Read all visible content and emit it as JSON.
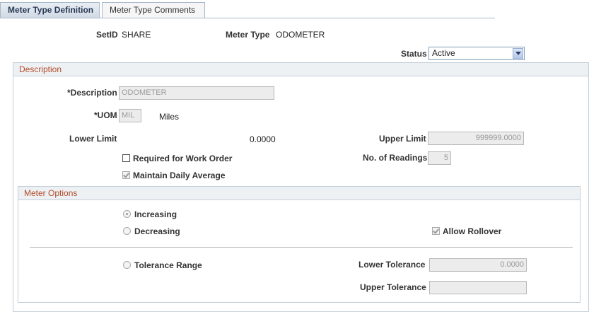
{
  "tabs": [
    {
      "label": "Meter Type Definition",
      "active": true
    },
    {
      "label": "Meter Type Comments",
      "active": false
    }
  ],
  "header": {
    "setid_label": "SetID",
    "setid_value": "SHARE",
    "meter_type_label": "Meter Type",
    "meter_type_value": "ODOMETER",
    "status_label": "Status",
    "status_value": "Active"
  },
  "description_group": {
    "title": "Description",
    "description_label": "*Description",
    "description_value": "ODOMETER",
    "uom_label": "*UOM",
    "uom_value": "MIL",
    "uom_desc": "Miles",
    "lower_limit_label": "Lower Limit",
    "lower_limit_value": "0.0000",
    "upper_limit_label": "Upper Limit",
    "upper_limit_value": "999999.0000",
    "required_wo_label": "Required for Work Order",
    "required_wo_checked": false,
    "readings_label": "No. of Readings",
    "readings_value": "5",
    "daily_avg_label": "Maintain Daily Average",
    "daily_avg_checked": true
  },
  "meter_options": {
    "title": "Meter Options",
    "increasing_label": "Increasing",
    "decreasing_label": "Decreasing",
    "rollover_label": "Allow Rollover",
    "tolerance_label": "Tolerance Range",
    "lower_tol_label": "Lower Tolerance",
    "lower_tol_value": "0.0000",
    "upper_tol_label": "Upper Tolerance",
    "upper_tol_value": ""
  },
  "colors": {
    "group_title": "#b24b2a",
    "group_border": "#c4cfd9",
    "tab_active_bg": "#cfd9e4"
  }
}
